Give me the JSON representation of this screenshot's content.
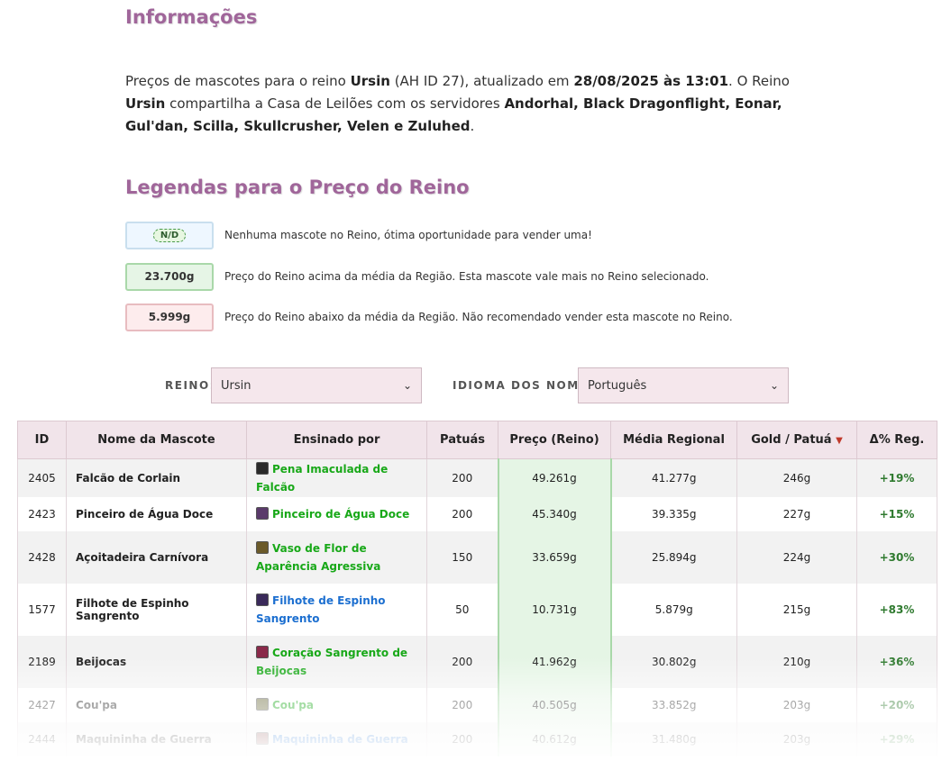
{
  "info": {
    "title": "Informações",
    "intro_1": "Preços de mascotes para o reino ",
    "realm": "Ursin",
    "intro_2": " (AH ID 27), atualizado em ",
    "updated": "28/08/2025 às 13:01",
    "intro_3": ". O Reino ",
    "intro_4": " compartilha a Casa de Leilões com os servidores ",
    "servers": "Andorhal, Black Dragonflight, Eonar, Gul'dan, Scilla, Skullcrusher, Velen e Zuluhed",
    "intro_5": "."
  },
  "legend": {
    "title": "Legendas para o Preço do Reino",
    "items": [
      {
        "box": "N/D",
        "text": "Nenhuma mascote no Reino, ótima oportunidade para vender uma!"
      },
      {
        "box": "23.700g",
        "text": "Preço do Reino acima da média da Região. Esta mascote vale mais no Reino selecionado."
      },
      {
        "box": "5.999g",
        "text": "Preço do Reino abaixo da média da Região. Não recomendado vender esta mascote no Reino."
      }
    ]
  },
  "filters": {
    "realm_label": "REINO:",
    "realm_value": "Ursin",
    "lang_label": "IDIOMA DOS NOMES:",
    "lang_value": "Português"
  },
  "table": {
    "headers": [
      "ID",
      "Nome da Mascote",
      "Ensinado por",
      "Patuás",
      "Preço (Reino)",
      "Média Regional",
      "Gold / Patuá",
      "Δ% Reg."
    ],
    "rows": [
      {
        "id": "2405",
        "name": "Falcão de Corlain",
        "teach": "Pena Imaculada de Falcão",
        "patuas": "200",
        "price": "49.261g",
        "avg": "41.277g",
        "gold": "246g",
        "delta": "+19%"
      },
      {
        "id": "2423",
        "name": "Pinceiro de Água Doce",
        "teach": "Pinceiro de Água Doce",
        "patuas": "200",
        "price": "45.340g",
        "avg": "39.335g",
        "gold": "227g",
        "delta": "+15%"
      },
      {
        "id": "2428",
        "name": "Açoitadeira Carnívora",
        "teach": "Vaso de Flor de Aparência Agressiva",
        "patuas": "150",
        "price": "33.659g",
        "avg": "25.894g",
        "gold": "224g",
        "delta": "+30%"
      },
      {
        "id": "1577",
        "name": "Filhote de Espinho Sangrento",
        "teach": "Filhote de Espinho Sangrento",
        "patuas": "50",
        "price": "10.731g",
        "avg": "5.879g",
        "gold": "215g",
        "delta": "+83%"
      },
      {
        "id": "2189",
        "name": "Beijocas",
        "teach": "Coração Sangrento de Beijocas",
        "patuas": "200",
        "price": "41.962g",
        "avg": "30.802g",
        "gold": "210g",
        "delta": "+36%"
      },
      {
        "id": "2427",
        "name": "Cou'pa",
        "teach": "Cou'pa",
        "patuas": "200",
        "price": "40.505g",
        "avg": "33.852g",
        "gold": "203g",
        "delta": "+20%"
      },
      {
        "id": "2444",
        "name": "Maquininha de Guerra",
        "teach": "Maquininha de Guerra",
        "patuas": "200",
        "price": "40.612g",
        "avg": "31.480g",
        "gold": "203g",
        "delta": "+29%"
      }
    ]
  }
}
